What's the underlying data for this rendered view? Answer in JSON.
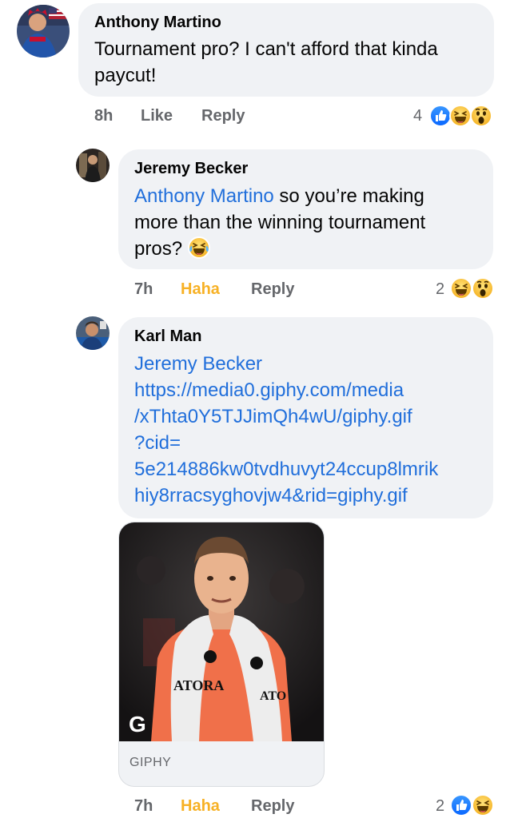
{
  "comments": [
    {
      "author": "Anthony Martino",
      "text": "Tournament pro?  I can't afford that kinda paycut!",
      "time": "8h",
      "like_label": "Like",
      "reply_label": "Reply",
      "reaction_count": "4",
      "reactions": [
        "like",
        "haha",
        "wow"
      ]
    },
    {
      "author": "Jeremy Becker",
      "mention": "Anthony Martino",
      "text": " so you’re making more than the winning tournament pros? ",
      "emoji": "tears-of-joy",
      "time": "7h",
      "like_label": "Haha",
      "reply_label": "Reply",
      "reaction_count": "2",
      "reactions": [
        "haha",
        "wow"
      ]
    },
    {
      "author": "Karl Man",
      "mention": "Jeremy Becker",
      "link_lines": [
        "https://media0.giphy.com/media",
        "/xThta0Y5TJJimQh4wU/giphy.gif",
        "?cid=",
        "5e214886kw0tvdhuvyt24ccup8lmrik",
        "hiy8rracsyghovjw4&rid=giphy.gif"
      ],
      "gif": {
        "source_label": "GIPHY",
        "towel_text_left": "ATORA",
        "towel_text_right": "ATO",
        "corner_logo": "G"
      },
      "time": "7h",
      "like_label": "Haha",
      "reply_label": "Reply",
      "reaction_count": "2",
      "reactions": [
        "like",
        "haha"
      ]
    }
  ],
  "colors": {
    "link": "#216fdb",
    "haha_active": "#f7b125",
    "meta": "#65676b",
    "bubble": "#f0f2f5",
    "like_blue": "#1877f2"
  }
}
